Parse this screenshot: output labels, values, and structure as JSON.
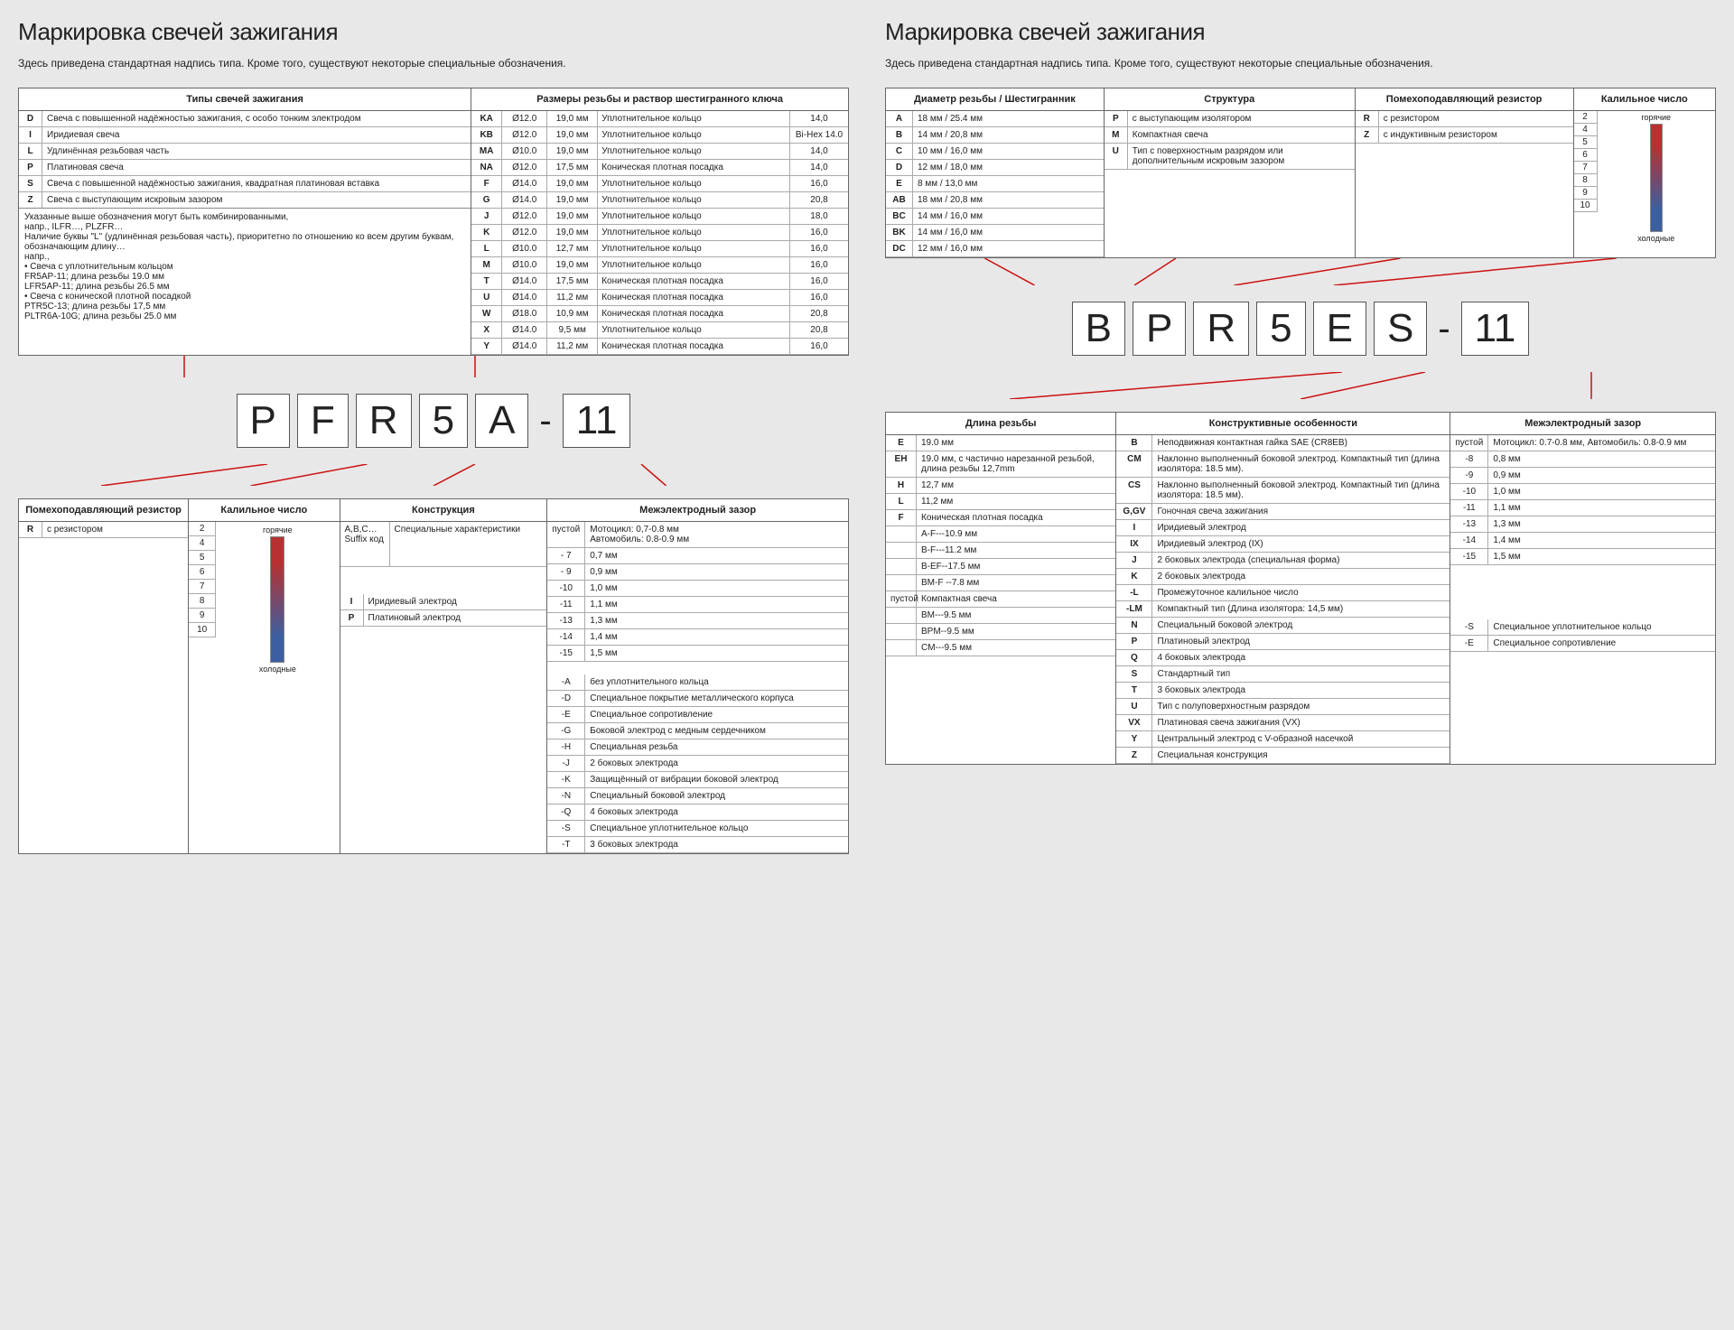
{
  "left": {
    "title": "Маркировка свечей зажигания",
    "subtitle": "Здесь приведена стандартная надпись типа. Кроме того, существуют некоторые специальные обозначения.",
    "top_left_header": "Типы свечей зажигания",
    "top_right_header": "Размеры резьбы и раствор шестигранного ключа",
    "types": [
      {
        "c": "D",
        "d": "Свеча с повышенной надёжностью зажигания, с особо тонким электродом"
      },
      {
        "c": "I",
        "d": "Иридиевая свеча"
      },
      {
        "c": "L",
        "d": "Удлинённая резьбовая часть"
      },
      {
        "c": "P",
        "d": "Платиновая свеча"
      },
      {
        "c": "S",
        "d": "Свеча с повышенной надёжностью зажигания, квадратная платиновая вставка"
      },
      {
        "c": "Z",
        "d": "Свеча с выступающим искровым зазором"
      }
    ],
    "notes": [
      "Указанные выше обозначения могут быть комбинированными,",
      "напр., ILFR…, PLZFR…",
      "Наличие буквы \"L\" (удлинённая резьбовая часть), приоритетно по отношению ко всем другим буквам, обозначающим длину…",
      "напр.,",
      "• Свеча с уплотнительным кольцом",
      "  FR5AP-11; длина резьбы 19.0 мм",
      "  LFR5AP-11; длина резьбы 26.5 мм",
      "• Свеча с конической плотной посадкой",
      "  PTR5C-13; длина резьбы 17,5 мм",
      "  PLTR6A-10G; длина резьбы 25.0 мм"
    ],
    "thread_rows": [
      [
        "KA",
        "Ø12.0",
        "19,0 мм",
        "Уплотнительное кольцо",
        "14,0"
      ],
      [
        "KB",
        "Ø12.0",
        "19,0 мм",
        "Уплотнительное кольцо",
        "Bi-Hex 14.0"
      ],
      [
        "MA",
        "Ø10.0",
        "19,0 мм",
        "Уплотнительное кольцо",
        "14,0"
      ],
      [
        "NA",
        "Ø12.0",
        "17,5 мм",
        "Коническая плотная посадка",
        "14,0"
      ],
      [
        "F",
        "Ø14.0",
        "19,0 мм",
        "Уплотнительное кольцо",
        "16,0"
      ],
      [
        "G",
        "Ø14.0",
        "19,0 мм",
        "Уплотнительное кольцо",
        "20,8"
      ],
      [
        "J",
        "Ø12.0",
        "19,0 мм",
        "Уплотнительное кольцо",
        "18,0"
      ],
      [
        "K",
        "Ø12.0",
        "19,0 мм",
        "Уплотнительное кольцо",
        "16,0"
      ],
      [
        "L",
        "Ø10.0",
        "12,7 мм",
        "Уплотнительное кольцо",
        "16,0"
      ],
      [
        "M",
        "Ø10.0",
        "19,0 мм",
        "Уплотнительное кольцо",
        "16,0"
      ],
      [
        "T",
        "Ø14.0",
        "17,5 мм",
        "Коническая плотная посадка",
        "16,0"
      ],
      [
        "U",
        "Ø14.0",
        "11,2 мм",
        "Коническая плотная посадка",
        "16,0"
      ],
      [
        "W",
        "Ø18.0",
        "10,9 мм",
        "Коническая плотная посадка",
        "20,8"
      ],
      [
        "X",
        "Ø14.0",
        "9,5 мм",
        "Уплотнительное кольцо",
        "20,8"
      ],
      [
        "Y",
        "Ø14.0",
        "11,2 мм",
        "Коническая плотная посадка",
        "16,0"
      ]
    ],
    "code": [
      "P",
      "F",
      "R",
      "5",
      "A",
      "-",
      "11"
    ],
    "bh1": "Помехоподавляющий резистор",
    "bh2": "Калильное число",
    "bh3": "Конструкция",
    "bh4": "Межэлектродный зазор",
    "resistor": {
      "c": "R",
      "d": "с резистором"
    },
    "heat_nums": [
      "2",
      "4",
      "5",
      "6",
      "7",
      "8",
      "9",
      "10"
    ],
    "heat_hot": "горячие",
    "heat_cold": "холодные",
    "constr_abc_l": "A,B,C…\nSuffix код",
    "constr_abc_r": "Специальные характеристики",
    "constr_rows": [
      {
        "c": "I",
        "d": "Иридиевый электрод"
      },
      {
        "c": "P",
        "d": "Платиновый электрод"
      }
    ],
    "gap_head": {
      "c": "пустой",
      "d": "Мотоцикл: 0,7-0.8 мм\nАвтомобиль: 0.8-0.9 мм"
    },
    "gap_rows": [
      [
        "- 7",
        "0,7 мм"
      ],
      [
        "- 9",
        "0,9 мм"
      ],
      [
        "-10",
        "1,0 мм"
      ],
      [
        "-11",
        "1,1 мм"
      ],
      [
        "-13",
        "1,3 мм"
      ],
      [
        "-14",
        "1,4 мм"
      ],
      [
        "-15",
        "1,5 мм"
      ]
    ],
    "gap_suffix": [
      [
        "-A",
        "без уплотнительного кольца"
      ],
      [
        "-D",
        "Специальное покрытие металлического корпуса"
      ],
      [
        "-E",
        "Специальное сопротивление"
      ],
      [
        "-G",
        "Боковой электрод с медным сердечником"
      ],
      [
        "-H",
        "Специальная резьба"
      ],
      [
        "-J",
        "2 боковых электрода"
      ],
      [
        "-K",
        "Защищённый от вибрации боковой электрод"
      ],
      [
        "-N",
        "Специальный боковой электрод"
      ],
      [
        "-Q",
        "4 боковых электрода"
      ],
      [
        "-S",
        "Специальное уплотнительное кольцо"
      ],
      [
        "-T",
        "3 боковых электрода"
      ]
    ]
  },
  "right": {
    "title": "Маркировка свечей зажигания",
    "subtitle": "Здесь приведена стандартная надпись типа. Кроме того, существуют некоторые специальные обозначения.",
    "h1": "Диаметр резьбы / Шестигранник",
    "h2": "Структура",
    "h3": "Помехоподавляющий резистор",
    "h4": "Калильное число",
    "thread": [
      [
        "A",
        "18 мм / 25.4 мм"
      ],
      [
        "B",
        "14 мм / 20,8 мм"
      ],
      [
        "C",
        "10 мм / 16,0 мм"
      ],
      [
        "D",
        "12 мм / 18,0 мм"
      ],
      [
        "E",
        "  8 мм / 13,0 мм"
      ],
      [
        "AB",
        "18 мм / 20,8 мм"
      ],
      [
        "BC",
        "14 мм / 16,0 мм"
      ],
      [
        "BK",
        "14 мм / 16,0 мм"
      ],
      [
        "DC",
        "12 мм / 16,0 мм"
      ]
    ],
    "struct": [
      [
        "P",
        "с выступающим изолятором"
      ],
      [
        "M",
        "Компактная свеча"
      ],
      [
        "U",
        "Тип с поверхностным разрядом или дополнительным искровым зазором"
      ]
    ],
    "resistor": [
      [
        "R",
        "с резистором"
      ],
      [
        "Z",
        "с индуктивным резистором"
      ]
    ],
    "hot": "горячие",
    "cold": "холодные",
    "heat_nums": [
      "2",
      "4",
      "5",
      "6",
      "7",
      "8",
      "9",
      "10"
    ],
    "code": [
      "B",
      "P",
      "R",
      "5",
      "E",
      "S",
      "-",
      "11"
    ],
    "bh1": "Длина резьбы",
    "bh2": "Конструктивные особенности",
    "bh3": "Межэлектродный зазор",
    "len_rows": [
      [
        "E",
        "19.0 мм"
      ],
      [
        "EH",
        "19.0 мм, с частично нарезанной резьбой, длина резьбы 12,7mm"
      ],
      [
        "H",
        "12,7 мм"
      ],
      [
        "L",
        "11,2 мм"
      ],
      [
        "F",
        "Коническая плотная посадка"
      ]
    ],
    "len_sub": [
      "A-F---10.9 мм",
      "B-F---11.2 мм",
      "B-EF--17.5 мм",
      "BM-F --7.8 мм"
    ],
    "len_empty_label": "пустой",
    "len_empty": "Компактная свеча",
    "len_sub2": [
      "BM---9.5 мм",
      "BPM--9.5 мм",
      "CM---9.5 мм"
    ],
    "feat": [
      [
        "B",
        "Неподвижная контактная гайка SAE (CR8EB)"
      ],
      [
        "CM",
        "Наклонно выполненный боковой электрод. Компактный тип (длина изолятора: 18.5 мм)."
      ],
      [
        "CS",
        "Наклонно выполненный боковой электрод. Компактный тип (длина изолятора: 18.5 мм)."
      ],
      [
        "G,GV",
        "Гоночная свеча зажигания"
      ],
      [
        "I",
        "Иридиевый электрод"
      ],
      [
        "IX",
        "Иридиевый электрод (IX)"
      ],
      [
        "J",
        "2 боковых электрода (специальная форма)"
      ],
      [
        "K",
        "2 боковых электрода"
      ],
      [
        "-L",
        "Промежуточное калильное число"
      ],
      [
        "-LM",
        "Компактный тип (Длина изолятора: 14,5 мм)"
      ],
      [
        "N",
        "Специальный боковой электрод"
      ],
      [
        "P",
        "Платиновый электрод"
      ],
      [
        "Q",
        "4 боковых электрода"
      ],
      [
        "S",
        "Стандартный тип"
      ],
      [
        "T",
        "3 боковых электрода"
      ],
      [
        "U",
        "Тип с полуповерхностным разрядом"
      ],
      [
        "VX",
        "Платиновая свеча зажигания (VX)"
      ],
      [
        "Y",
        "Центральный электрод с V-образной насечкой"
      ],
      [
        "Z",
        "Специальная конструкция"
      ]
    ],
    "gap_head": [
      "пустой",
      "Мотоцикл: 0.7-0.8 мм, Автомобиль: 0.8-0.9 мм"
    ],
    "gap": [
      [
        "-8",
        "0,8 мм"
      ],
      [
        "-9",
        "0,9 мм"
      ],
      [
        "-10",
        "1,0 мм"
      ],
      [
        "-11",
        "1,1 мм"
      ],
      [
        "-13",
        "1,3 мм"
      ],
      [
        "-14",
        "1,4 мм"
      ],
      [
        "-15",
        "1,5 мм"
      ]
    ],
    "gap_extra": [
      [
        "-S",
        "Специальное уплотнительное кольцо"
      ],
      [
        "-E",
        "Специальное сопротивление"
      ]
    ]
  }
}
